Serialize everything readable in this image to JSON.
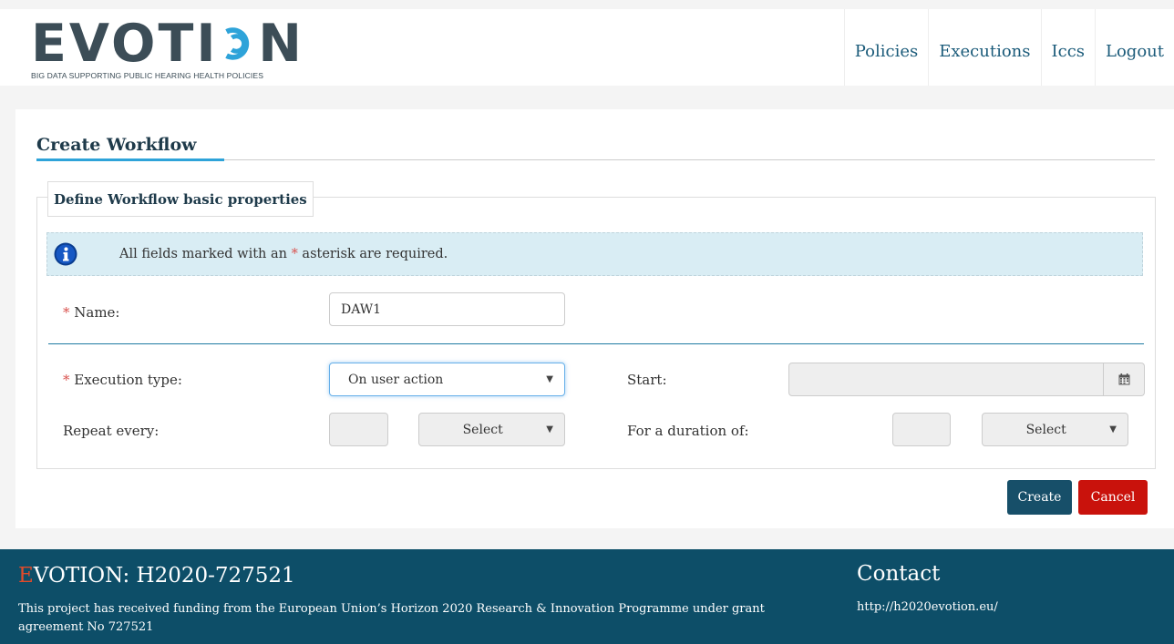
{
  "brand": {
    "name": "EVOTION",
    "logo_letters_left": "EVOTI",
    "logo_letters_right": "N",
    "tagline": "BIG DATA SUPPORTING PUBLIC HEARING HEALTH POLICIES",
    "color": "#3c4d57"
  },
  "nav": {
    "items": [
      {
        "label": "Policies"
      },
      {
        "label": "Executions"
      },
      {
        "label": "Iccs"
      },
      {
        "label": "Logout"
      }
    ]
  },
  "page": {
    "title": "Create Workflow"
  },
  "form": {
    "legend": "Define Workflow basic properties",
    "info": {
      "icon": "info-circle-icon",
      "text_before": "All fields marked with an ",
      "asterisk": "*",
      "text_after": " asterisk are required."
    },
    "name": {
      "required_mark": "*",
      "label": " Name:",
      "value": "DAW1"
    },
    "execution_type": {
      "required_mark": "*",
      "label": " Execution type:",
      "value": "On user action",
      "caret": "▼"
    },
    "start": {
      "label": "Start:",
      "value": "",
      "icon": "calendar-icon"
    },
    "repeat_every": {
      "label": "Repeat every:",
      "value": "",
      "unit": "Select",
      "caret": "▼"
    },
    "duration": {
      "label": "For a duration of:",
      "value": "",
      "unit": "Select",
      "caret": "▼"
    }
  },
  "actions": {
    "create_label": "Create",
    "cancel_label": "Cancel"
  },
  "footer": {
    "title_initial": "E",
    "title_rest": "VOTION: H2020-727521",
    "text": "This project has received funding from the European Union’s Horizon 2020 Research & Innovation Programme under grant agreement No 727521",
    "contact_title": "Contact",
    "contact_url": "http://h2020evotion.eu/"
  },
  "colors": {
    "accent": "#2ea3d9",
    "primary_button": "#174f69",
    "danger_button": "#c9120c",
    "footer_bg": "#0d4e68",
    "link": "#1b5b7a"
  }
}
